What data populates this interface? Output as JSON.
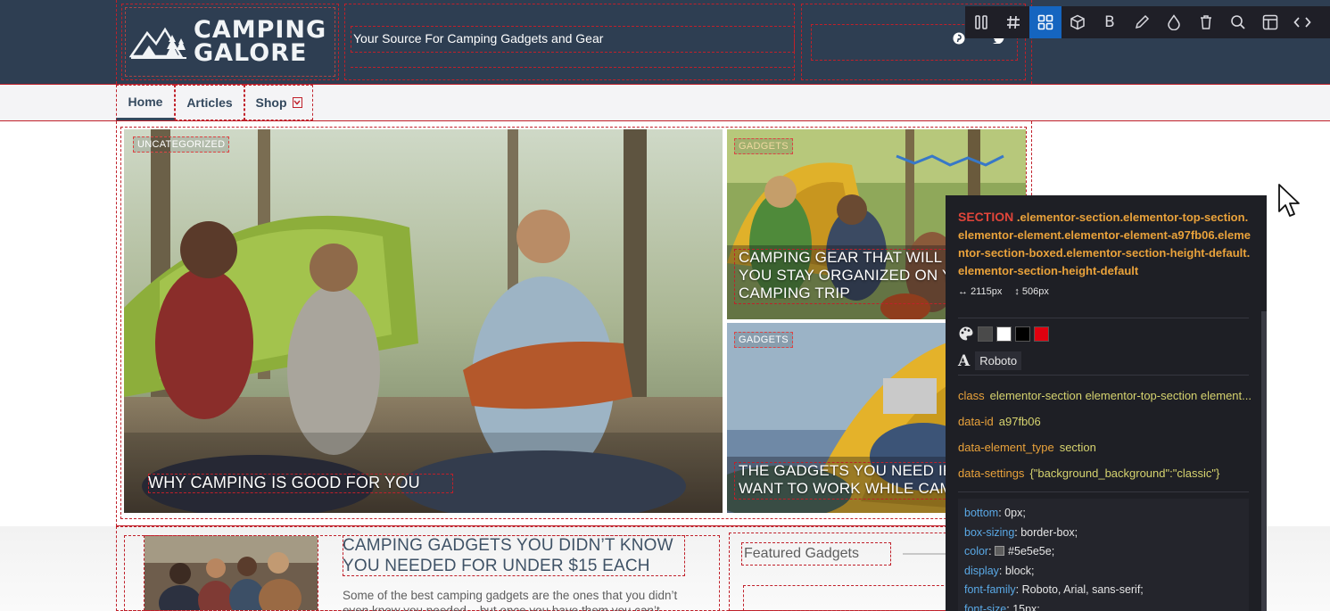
{
  "header": {
    "logo_line1": "CAMPING",
    "logo_line2": "GALORE",
    "tagline": "Your Source For Camping Gadgets and Gear",
    "social": [
      "pinterest-icon",
      "twitter-icon"
    ]
  },
  "toolbar": {
    "buttons": [
      "columns-icon",
      "hash-icon",
      "grid-icon",
      "cube-icon",
      "bold-icon",
      "pencil-icon",
      "drop-icon",
      "trash-icon",
      "search-icon",
      "layout-icon",
      "code-icon"
    ],
    "active": "grid-icon"
  },
  "nav": {
    "items": [
      {
        "label": "Home"
      },
      {
        "label": "Articles"
      },
      {
        "label": "Shop"
      }
    ]
  },
  "grid": {
    "main": {
      "category": "UNCATEGORIZED",
      "title": "WHY CAMPING IS GOOD FOR YOU"
    },
    "top_right": {
      "category": "GADGETS",
      "title": "CAMPING GEAR THAT WILL HELP YOU STAY ORGANIZED ON YOUR CAMPING TRIP"
    },
    "bottom_right": {
      "category": "GADGETS",
      "title": "THE GADGETS YOU NEED IF YOU WANT TO WORK WHILE CAMPING"
    }
  },
  "bottom": {
    "post_title": "CAMPING GADGETS YOU DIDN’T KNOW YOU NEEDED FOR UNDER $15 EACH",
    "post_excerpt": "Some of the best camping gadgets are the ones that you didn’t even know you needed – but once you have them you can’t picture",
    "featured_heading": "Featured Gadgets"
  },
  "inspector": {
    "tag": "SECTION",
    "classes": ".elementor-section.elementor-top-section.elementor-element.elementor-element-a97fb06.elementor-section-boxed.elementor-section-height-default.elementor-section-height-default",
    "width": "2115px",
    "height": "506px",
    "colors": [
      "#4a4a4a",
      "#ffffff",
      "#000000",
      "#e0000f"
    ],
    "font": "Roboto",
    "attrs": [
      {
        "k": "class",
        "v": "elementor-section elementor-top-section element..."
      },
      {
        "k": "data-id",
        "v": "a97fb06"
      },
      {
        "k": "data-element_type",
        "v": "section"
      },
      {
        "k": "data-settings",
        "v": "{\"background_background\":\"classic\"}"
      }
    ],
    "css": [
      {
        "k": "bottom",
        "v": "0px;"
      },
      {
        "k": "box-sizing",
        "v": "border-box;"
      },
      {
        "k": "color",
        "v": "#5e5e5e;"
      },
      {
        "k": "display",
        "v": "block;"
      },
      {
        "k": "font-family",
        "v": "Roboto, Arial, sans-serif;"
      },
      {
        "k": "font-size",
        "v": "15px;"
      }
    ]
  }
}
